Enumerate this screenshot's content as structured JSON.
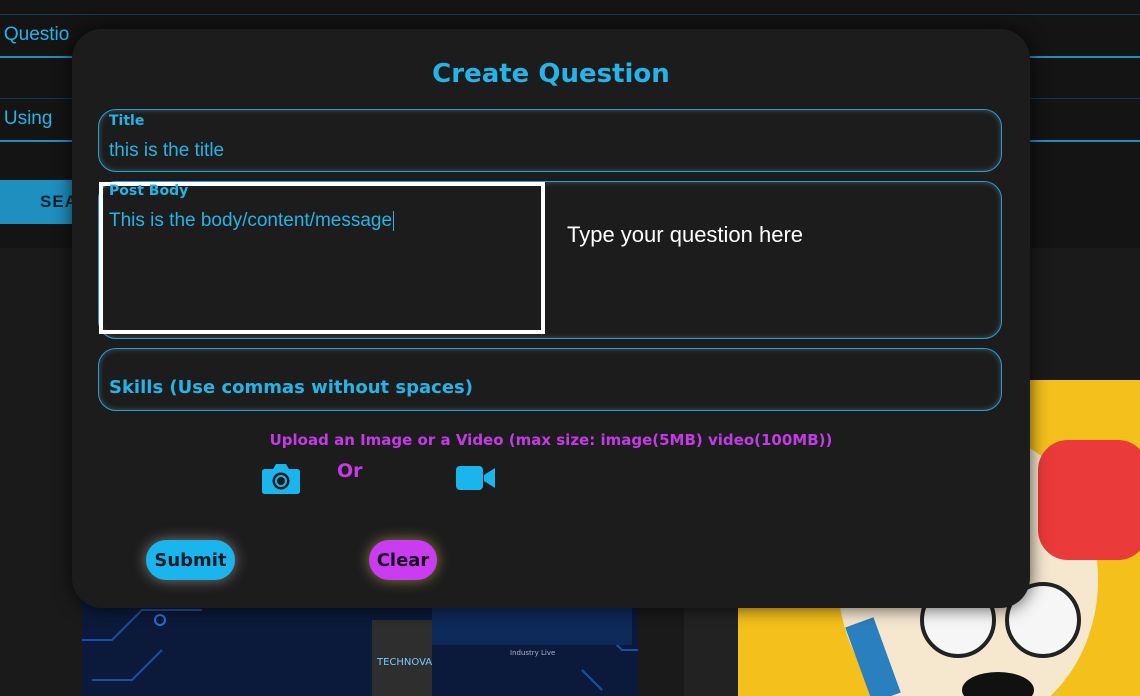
{
  "background": {
    "search_question": "h Questio",
    "search_using": "h Using",
    "search_button": "SEA",
    "card_logo": "TECHNOVA",
    "card_caption": "Industry Live"
  },
  "modal": {
    "title": "Create Question",
    "title_field": {
      "label": "Title",
      "value": "this is the title"
    },
    "body_field": {
      "label": "Post Body",
      "value": "This is the body/content/message",
      "hint": "Type your question here"
    },
    "skills_field": {
      "label": "Skills (Use commas without spaces)"
    },
    "upload": {
      "text": "Upload an Image or a Video (max size: image(5MB) video(100MB))",
      "or_text": "Or",
      "image_icon": "camera-icon",
      "video_icon": "video-camera-icon"
    },
    "buttons": {
      "submit": "Submit",
      "clear": "Clear"
    }
  },
  "colors": {
    "accent": "#26b3e6",
    "purple": "#c33ae6",
    "modal_bg": "#1c1c1c",
    "page_bg": "#1a1a1a"
  }
}
